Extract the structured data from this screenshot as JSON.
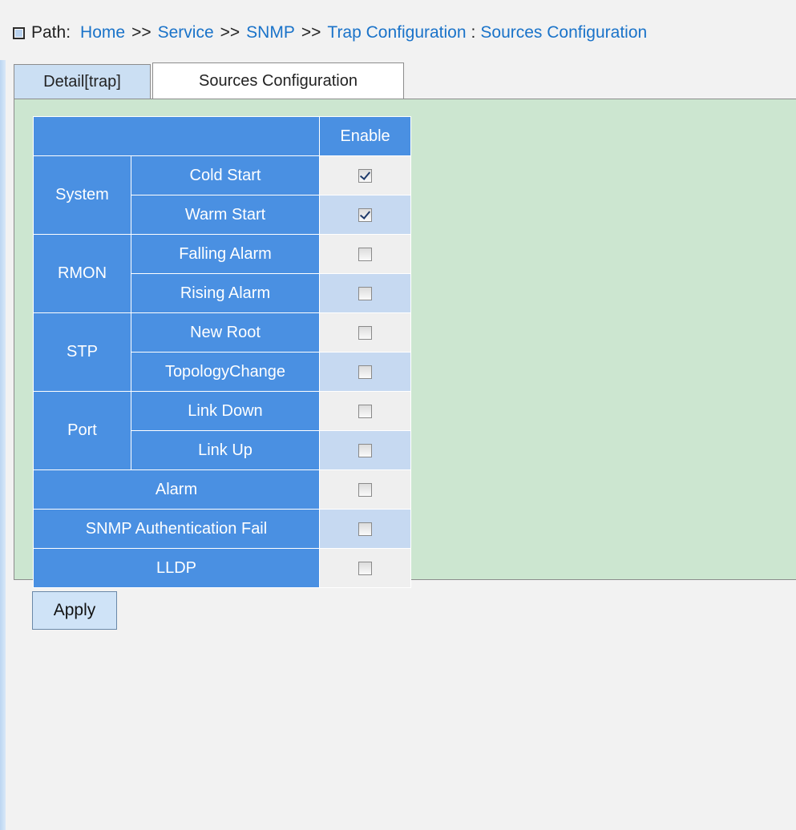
{
  "path": {
    "label": "Path:",
    "crumbs": [
      "Home",
      "Service",
      "SNMP",
      "Trap Configuration"
    ],
    "separator": ">>",
    "current_separator": ":",
    "current": "Sources Configuration"
  },
  "tabs": [
    {
      "label": "Detail[trap]",
      "active": false
    },
    {
      "label": "Sources Configuration",
      "active": true
    }
  ],
  "table": {
    "header_enable": "Enable",
    "groups": [
      {
        "name": "System",
        "items": [
          {
            "label": "Cold Start",
            "checked": true
          },
          {
            "label": "Warm Start",
            "checked": true
          }
        ]
      },
      {
        "name": "RMON",
        "items": [
          {
            "label": "Falling Alarm",
            "checked": false
          },
          {
            "label": "Rising Alarm",
            "checked": false
          }
        ]
      },
      {
        "name": "STP",
        "items": [
          {
            "label": "New Root",
            "checked": false
          },
          {
            "label": "TopologyChange",
            "checked": false
          }
        ]
      },
      {
        "name": "Port",
        "items": [
          {
            "label": "Link Down",
            "checked": false
          },
          {
            "label": "Link Up",
            "checked": false
          }
        ]
      }
    ],
    "singles": [
      {
        "label": "Alarm",
        "checked": false
      },
      {
        "label": "SNMP Authentication Fail",
        "checked": false
      },
      {
        "label": "LLDP",
        "checked": false
      }
    ]
  },
  "apply_label": "Apply",
  "colors": {
    "header_blue": "#4a90e2",
    "panel_green": "#cce6d0",
    "link_blue": "#1a73c9",
    "row_alt": "#c6d9f1"
  }
}
